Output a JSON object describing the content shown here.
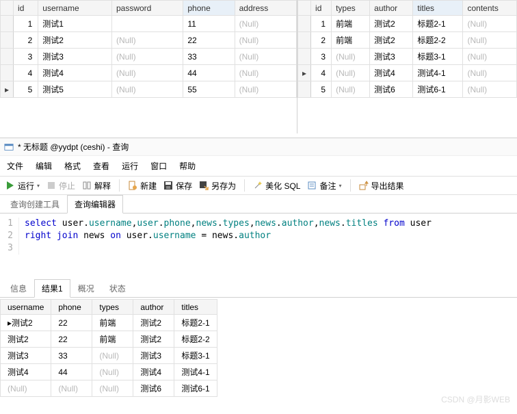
{
  "user_table": {
    "columns": [
      "id",
      "username",
      "password",
      "phone",
      "address"
    ],
    "highlight_col": "phone",
    "rows": [
      {
        "id": "1",
        "username": "测试1",
        "password": "",
        "phone": "11",
        "address": null
      },
      {
        "id": "2",
        "username": "测试2",
        "password": null,
        "phone": "22",
        "address": null
      },
      {
        "id": "3",
        "username": "测试3",
        "password": null,
        "phone": "33",
        "address": null
      },
      {
        "id": "4",
        "username": "测试4",
        "password": null,
        "phone": "44",
        "address": null
      },
      {
        "id": "5",
        "username": "测试5",
        "password": null,
        "phone": "55",
        "address": null
      }
    ],
    "active_row": 4
  },
  "news_table": {
    "columns": [
      "id",
      "types",
      "author",
      "titles",
      "contents"
    ],
    "highlight_col": "titles",
    "rows": [
      {
        "id": "1",
        "types": "前端",
        "author": "测试2",
        "titles": "标题2-1",
        "contents": null
      },
      {
        "id": "2",
        "types": "前端",
        "author": "测试2",
        "titles": "标题2-2",
        "contents": null
      },
      {
        "id": "3",
        "types": null,
        "author": "测试3",
        "titles": "标题3-1",
        "contents": null
      },
      {
        "id": "4",
        "types": null,
        "author": "测试4",
        "titles": "测试4-1",
        "contents": null
      },
      {
        "id": "5",
        "types": null,
        "author": "测试6",
        "titles": "测试6-1",
        "contents": null
      }
    ],
    "active_row": 3
  },
  "window": {
    "title": "* 无标题 @yydpt (ceshi) - 查询"
  },
  "menu": {
    "file": "文件",
    "edit": "编辑",
    "format": "格式",
    "view": "查看",
    "run": "运行",
    "window": "窗口",
    "help": "帮助"
  },
  "toolbar": {
    "run": "运行",
    "stop": "停止",
    "explain": "解释",
    "new": "新建",
    "save": "保存",
    "saveas": "另存为",
    "beautify": "美化 SQL",
    "note": "备注",
    "export": "导出结果"
  },
  "editor_tabs": {
    "builder": "查询创建工具",
    "editor": "查询编辑器"
  },
  "sql": {
    "line1_parts": [
      "select",
      " user",
      ".",
      "username",
      ",",
      "user",
      ".",
      "phone",
      ",",
      "news",
      ".",
      "types",
      ",",
      "news",
      ".",
      "author",
      ",",
      "news",
      ".",
      "titles",
      " ",
      "from",
      " user"
    ],
    "line2_parts": [
      "right join",
      " news ",
      "on",
      " user",
      ".",
      "username",
      " = news",
      ".",
      "author"
    ]
  },
  "result_tabs": {
    "info": "信息",
    "result": "结果1",
    "profile": "概况",
    "status": "状态"
  },
  "result": {
    "columns": [
      "username",
      "phone",
      "types",
      "author",
      "titles"
    ],
    "rows": [
      {
        "username": "测试2",
        "phone": "22",
        "types": "前端",
        "author": "测试2",
        "titles": "标题2-1",
        "active": true
      },
      {
        "username": "测试2",
        "phone": "22",
        "types": "前端",
        "author": "测试2",
        "titles": "标题2-2"
      },
      {
        "username": "测试3",
        "phone": "33",
        "types": null,
        "author": "测试3",
        "titles": "标题3-1"
      },
      {
        "username": "测试4",
        "phone": "44",
        "types": null,
        "author": "测试4",
        "titles": "测试4-1"
      },
      {
        "username": null,
        "phone": null,
        "types": null,
        "author": "测试6",
        "titles": "测试6-1"
      }
    ]
  },
  "null_text": "(Null)",
  "watermark": "CSDN @月影WEB"
}
